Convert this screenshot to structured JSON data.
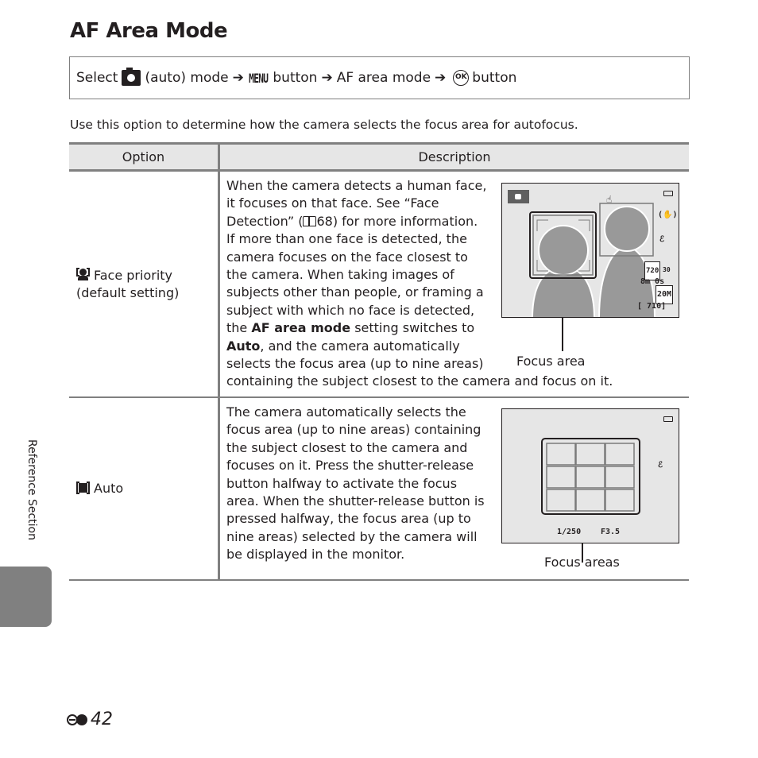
{
  "page": {
    "title": "AF Area Mode",
    "side_label": "Reference Section",
    "page_number": "42",
    "page_prefix_icon": "e-section-icon"
  },
  "nav_path": {
    "select": "Select",
    "mode_icon": "camera-auto-icon",
    "auto_mode": "(auto) mode",
    "arrow": "➔",
    "menu_label": "MENU",
    "menu_suffix": "button",
    "af_area_mode": "AF area mode",
    "ok_label": "OK",
    "ok_suffix": "button"
  },
  "intro": "Use this option to determine how the camera selects the focus area for autofocus.",
  "table": {
    "headers": [
      "Option",
      "Description"
    ],
    "rows": [
      {
        "icon": "face-priority-icon",
        "option_line1": "Face priority",
        "option_line2": "(default setting)",
        "desc_lines": [
          "When the camera detects a human face,",
          "it focuses on that face. See “Face",
          "Detection” (",
          "68) for more information.",
          "If more than one face is detected, the",
          "camera focuses on the face closest to",
          "the camera. When taking images of",
          "subjects other than people, or framing a",
          "subject with which no face is detected,",
          "the ",
          "AF area mode",
          " setting switches to",
          "Auto",
          ", and the camera automatically",
          "selects the focus area (up to nine areas)",
          "containing the subject closest to the camera and focus on it."
        ],
        "screen": {
          "indicators": [
            "720",
            "30",
            "8m 0s",
            "20M",
            "[ 710]"
          ],
          "caption": "Focus area"
        }
      },
      {
        "icon": "auto-area-icon",
        "option_line1": "Auto",
        "desc_lines": [
          "The camera automatically selects the",
          "focus area (up to nine areas) containing",
          "the subject closest to the camera and",
          "focuses on it. Press the shutter-release",
          "button halfway to activate the focus",
          "area. When the shutter-release button is",
          "pressed halfway, the focus area (up to",
          "nine areas) selected by the camera will",
          "be displayed in the monitor."
        ],
        "screen": {
          "shutter_speed": "1/250",
          "aperture": "F3.5",
          "caption": "Focus areas"
        }
      }
    ]
  }
}
